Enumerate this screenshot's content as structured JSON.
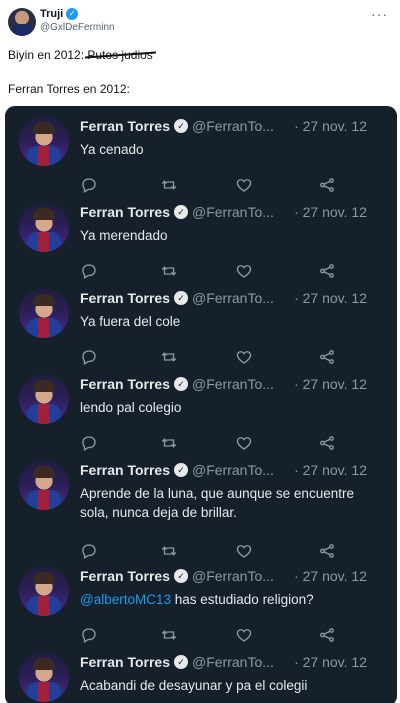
{
  "author": {
    "name": "Truji",
    "handle": "@GxlDeFerminn",
    "verified_symbol": "✓",
    "more_symbol": "···"
  },
  "post": {
    "line1_prefix": "Biyin en 2012:",
    "line1_struck": "Putos judios",
    "line2": "Ferran Torres en 2012:"
  },
  "tweets": [
    {
      "name": "Ferran Torres",
      "handle": "@FerranTo...",
      "date": "· 27 nov. 12",
      "text": "Ya cenado"
    },
    {
      "name": "Ferran Torres",
      "handle": "@FerranTo...",
      "date": "· 27 nov. 12",
      "text": "Ya merendado"
    },
    {
      "name": "Ferran Torres",
      "handle": "@FerranTo...",
      "date": "· 27 nov. 12",
      "text": "Ya fuera del cole"
    },
    {
      "name": "Ferran Torres",
      "handle": "@FerranTo...",
      "date": "· 27 nov. 12",
      "text": "lendo pal colegio"
    },
    {
      "name": "Ferran Torres",
      "handle": "@FerranTo...",
      "date": "· 27 nov. 12",
      "text": "Aprende de la luna, que aunque se encuentre sola, nunca deja de brillar."
    },
    {
      "name": "Ferran Torres",
      "handle": "@FerranTo...",
      "date": "· 27 nov. 12",
      "mention": "@albertoMC13",
      "text": " has estudiado religion?"
    },
    {
      "name": "Ferran Torres",
      "handle": "@FerranTo...",
      "date": "· 27 nov. 12",
      "text": "Acabandi de desayunar y pa el colegii"
    }
  ],
  "colors": {
    "panel_bg": "#15202b",
    "text_light": "#e7e9ea",
    "text_dim": "#8b98a5",
    "mention": "#1d9bf0",
    "verified": "#1d9bf0"
  },
  "icons": [
    "reply-icon",
    "retweet-icon",
    "like-icon",
    "share-icon"
  ]
}
